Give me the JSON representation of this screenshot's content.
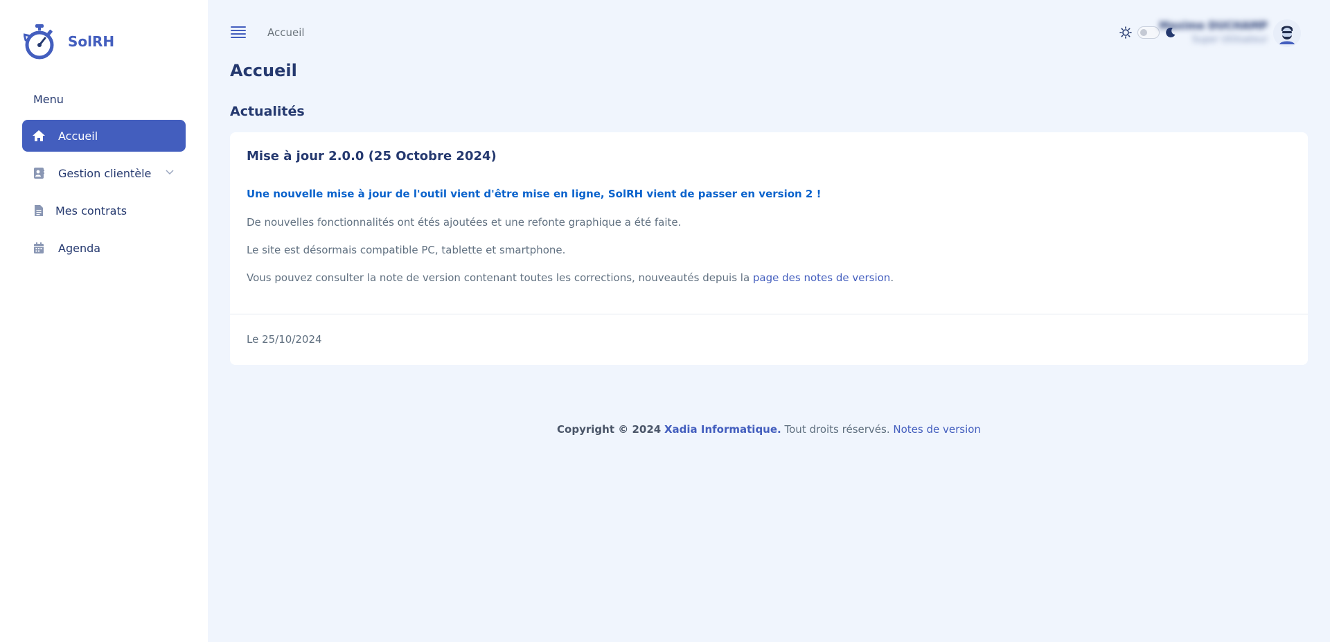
{
  "app": {
    "name": "SolRH"
  },
  "sidebar": {
    "menu_title": "Menu",
    "items": [
      {
        "label": "Accueil",
        "icon": "home-icon",
        "active": true
      },
      {
        "label": "Gestion clientèle",
        "icon": "contact-card-icon",
        "active": false,
        "has_submenu": true
      },
      {
        "label": "Mes contrats",
        "icon": "document-icon",
        "active": false
      },
      {
        "label": "Agenda",
        "icon": "calendar-icon",
        "active": false
      }
    ]
  },
  "header": {
    "breadcrumb": "Accueil",
    "theme_toggle": {
      "icon_light": "sun-icon",
      "icon_dark": "moon-icon",
      "dark_mode": false
    },
    "user": {
      "name": "Maxime DUCHAMP",
      "role": "Super Utilisateur"
    }
  },
  "page": {
    "title": "Accueil",
    "section_title": "Actualités"
  },
  "news": {
    "title": "Mise à jour 2.0.0 (25 Octobre 2024)",
    "lead": "Une nouvelle mise à jour de l'outil vient d'être mise en ligne, SolRH vient de passer en version 2 !",
    "p1": "De nouvelles fonctionnalités ont étés ajoutées et une refonte graphique a été faite.",
    "p2": "Le site est désormais compatible PC, tablette et smartphone.",
    "p3_before": "Vous pouvez consulter la note de version contenant toutes les corrections, nouveautés depuis la ",
    "p3_link": "page des notes de version",
    "p3_after": ".",
    "date": "Le 25/10/2024"
  },
  "footer": {
    "copyright": "Copyright © 2024",
    "company": "Xadia Informatique.",
    "rights": "Tout droits réservés.",
    "notes_link": "Notes de version"
  },
  "colors": {
    "primary": "#435ebe",
    "background": "#f0f5fd",
    "text_dark": "#25396f",
    "lead_blue": "#0b63cc"
  }
}
